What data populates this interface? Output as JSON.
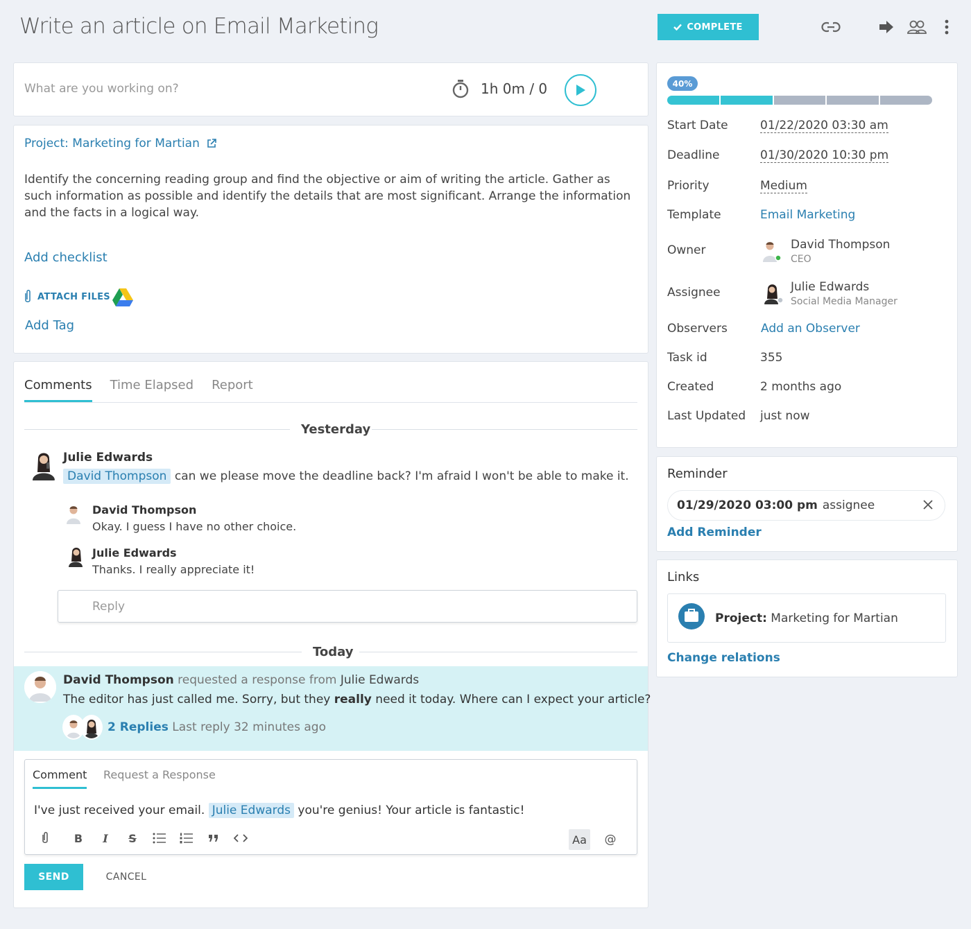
{
  "header": {
    "title": "Write an article on Email Marketing",
    "complete_label": "COMPLETE"
  },
  "timer": {
    "placeholder": "What are you working on?",
    "value": "1h 0m / 0"
  },
  "details": {
    "project_label": "Project: Marketing for Martian",
    "description": "Identify the concerning reading group and find the objective or aim of writing the article. Gather as such information as possible and identify the details that are most significant. Arrange the information and the facts in a logical way.",
    "add_checklist": "Add checklist",
    "attach_files": "ATTACH FILES",
    "add_tag": "Add Tag"
  },
  "tabs": [
    "Comments",
    "Time Elapsed",
    "Report"
  ],
  "comments": {
    "yesterday_label": "Yesterday",
    "today_label": "Today",
    "thread1": {
      "author": "Julie Edwards",
      "mention": "David Thompson",
      "text": "can we please move the deadline back? I'm afraid I won't be able to make it.",
      "replies": [
        {
          "author": "David Thompson",
          "text": "Okay. I guess I have no other choice."
        },
        {
          "author": "Julie Edwards",
          "text": "Thanks. I really appreciate it!"
        }
      ],
      "reply_placeholder": "Reply"
    },
    "thread2": {
      "author": "David Thompson",
      "action": "requested a response from",
      "target": "Julie Edwards",
      "text_before": "The editor has just called me. Sorry, but they",
      "text_bold": "really",
      "text_after": "need it today. Where can I expect your article?",
      "replies_count": "2 Replies",
      "last_reply": "Last reply 32 minutes ago"
    }
  },
  "composer": {
    "tabs": [
      "Comment",
      "Request a Response"
    ],
    "text_before": "I've just received your email.",
    "mention": "Julie Edwards",
    "text_after": "you're genius! Your article is fantastic!",
    "font_toggle": "Aa",
    "mention_btn": "@",
    "send_label": "SEND",
    "cancel_label": "CANCEL"
  },
  "progress": {
    "percent_label": "40%",
    "percent": 40,
    "segments": 5,
    "filled_color": "#35c3d3",
    "empty_color": "#adb6c4"
  },
  "properties": {
    "start_date_label": "Start Date",
    "start_date": "01/22/2020 03:30 am",
    "deadline_label": "Deadline",
    "deadline": "01/30/2020 10:30 pm",
    "priority_label": "Priority",
    "priority": "Medium",
    "template_label": "Template",
    "template": "Email Marketing",
    "owner_label": "Owner",
    "owner_name": "David Thompson",
    "owner_role": "CEO",
    "assignee_label": "Assignee",
    "assignee_name": "Julie Edwards",
    "assignee_role": "Social Media Manager",
    "observers_label": "Observers",
    "observers_action": "Add an Observer",
    "task_id_label": "Task id",
    "task_id": "355",
    "created_label": "Created",
    "created": "2 months ago",
    "updated_label": "Last Updated",
    "updated": "just now"
  },
  "reminder": {
    "title": "Reminder",
    "datetime": "01/29/2020 03:00 pm",
    "recipient": "assignee",
    "add_label": "Add Reminder"
  },
  "links": {
    "title": "Links",
    "item_type": "Project:",
    "item_name": "Marketing for Martian",
    "change_label": "Change relations"
  },
  "colors": {
    "accent": "#2fbfd2",
    "link": "#2a7fb0",
    "highlight_bg": "#d6f2f5"
  }
}
